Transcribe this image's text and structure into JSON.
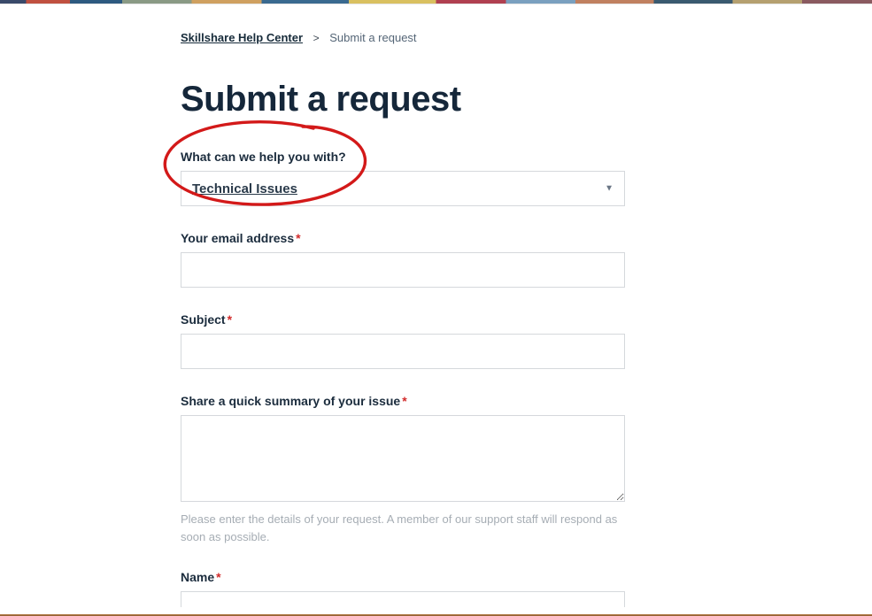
{
  "breadcrumb": {
    "home_label": "Skillshare Help Center",
    "current_label": "Submit a request"
  },
  "page_title": "Submit a request",
  "form": {
    "help_with": {
      "label": "What can we help you with?",
      "selected": "Technical Issues"
    },
    "email": {
      "label": "Your email address",
      "value": ""
    },
    "subject": {
      "label": "Subject",
      "value": ""
    },
    "summary": {
      "label": "Share a quick summary of your issue",
      "value": "",
      "hint": "Please enter the details of your request. A member of our support staff will respond as soon as possible."
    },
    "name": {
      "label": "Name",
      "value": ""
    }
  }
}
